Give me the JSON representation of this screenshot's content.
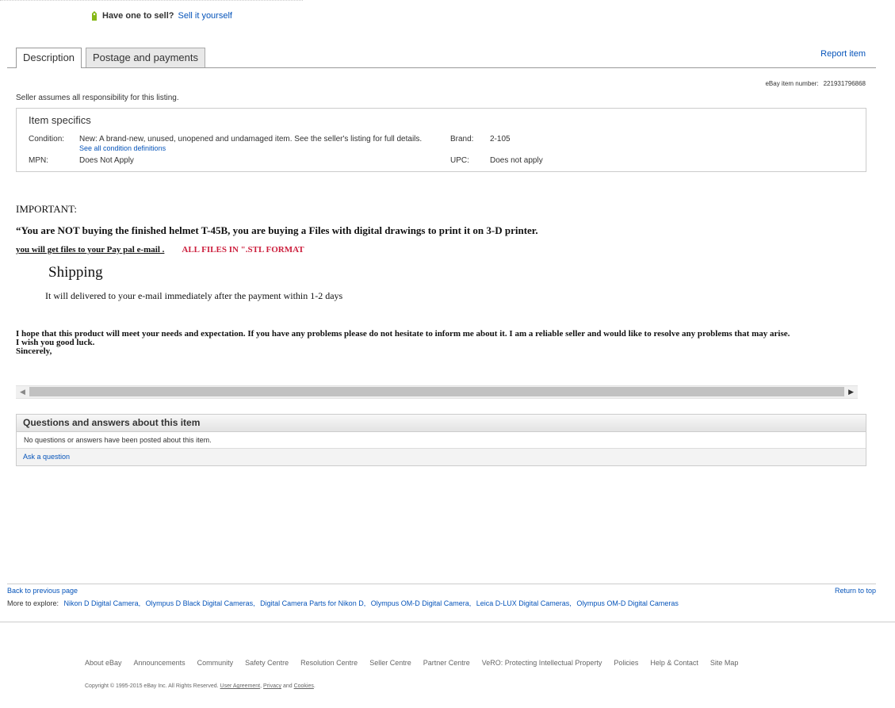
{
  "sell": {
    "question": "Have one to sell?",
    "link": "Sell it yourself"
  },
  "tabs": {
    "description": "Description",
    "postage": "Postage and payments"
  },
  "report_item": "Report item",
  "item_number": {
    "label": "eBay item number:",
    "value": "221931796868"
  },
  "seller_note": "Seller assumes all responsibility for this listing.",
  "specifics": {
    "title": "Item specifics",
    "condition_label": "Condition:",
    "condition_value": "New: A brand-new, unused, unopened and undamaged item. See the seller's listing for full details.",
    "condition_link": "See all condition definitions",
    "brand_label": "Brand:",
    "brand_value": "2-105",
    "mpn_label": "MPN:",
    "mpn_value": "Does Not Apply",
    "upc_label": "UPC:",
    "upc_value": "Does not apply"
  },
  "desc": {
    "important": "IMPORTANT:",
    "not_buying": "“You are NOT buying the finished helmet T-45B, you are buying a Files with digital drawings to print it on 3-D printer.",
    "files_line": "you will get files to your Pay pal e-mail .",
    "format": "ALL FILES IN \".STL FORMAT",
    "shipping_title": "Shipping",
    "shipping_text": "It will delivered  to your e-mail immediately after the payment within 1-2 days",
    "hope": "I hope that this product will meet your needs and expectation. If you have any problems please do not hesitate to inform me about it. I am a reliable seller and would like to resolve any problems that may arise.",
    "luck": "I wish you good luck.",
    "sincerely": "Sincerely,"
  },
  "qa": {
    "title": "Questions and answers about this item",
    "none": "No questions or answers have been posted about this item.",
    "ask": "Ask a question"
  },
  "footer": {
    "back": "Back to previous page",
    "return_top": "Return to top",
    "explore_label": "More to explore:",
    "explore": [
      "Nikon D Digital Camera,",
      "Olympus D Black Digital Cameras,",
      "Digital Camera Parts for Nikon D,",
      "Olympus OM-D Digital Camera,",
      "Leica D-LUX Digital Cameras,",
      "Olympus OM-D Digital Cameras"
    ],
    "nav": [
      "About eBay",
      "Announcements",
      "Community",
      "Safety Centre",
      "Resolution Centre",
      "Seller Centre",
      "Partner Centre",
      "VeRO: Protecting Intellectual Property",
      "Policies",
      "Help & Contact",
      "Site Map"
    ],
    "copyright": "Copyright © 1995-2015 eBay Inc. All Rights Reserved.",
    "user_agreement": "User Agreement",
    "privacy": "Privacy",
    "and": "and",
    "cookies": "Cookies"
  }
}
